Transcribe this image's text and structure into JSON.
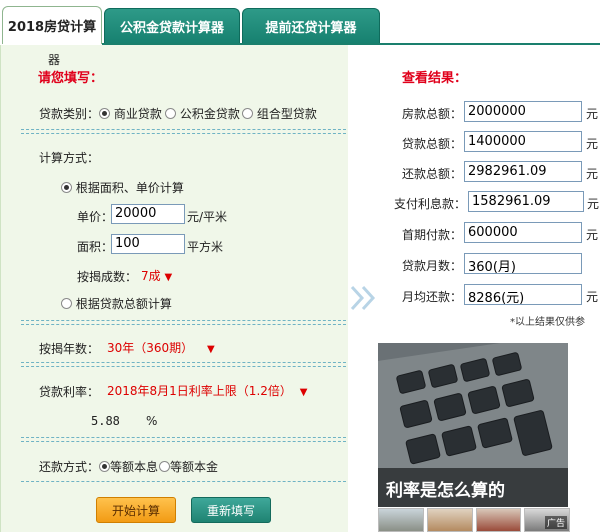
{
  "tabs": [
    {
      "label": "2018房贷计算"
    },
    {
      "label": "公积金贷款计算器"
    },
    {
      "label": "提前还贷计算器"
    }
  ],
  "left": {
    "stray_char": "器",
    "heading": "请您填写：",
    "loan_type": {
      "label": "贷款类别：",
      "options": [
        "商业贷款",
        "公积金贷款",
        "组合型贷款"
      ],
      "selected": 0
    },
    "calc_method": {
      "label": "计算方式：",
      "option_area": "根据面积、单价计算",
      "unit_price_label": "单价：",
      "unit_price_value": "20000",
      "unit_price_unit": "元/平米",
      "area_label": "面积：",
      "area_value": "100",
      "area_unit": "平方米",
      "mortgage_ratio_label": "按揭成数：",
      "mortgage_ratio_value": "7成",
      "option_total": "根据贷款总额计算"
    },
    "years": {
      "label": "按揭年数：",
      "value": "30年（360期）"
    },
    "rate": {
      "label": "贷款利率：",
      "value": "2018年8月1日利率上限（1.2倍）",
      "percent_value": "5.88",
      "percent_unit": "%"
    },
    "repay": {
      "label": "还款方式：",
      "options": [
        "等额本息",
        "等额本金"
      ],
      "selected": 0
    },
    "buttons": {
      "start": "开始计算",
      "reset": "重新填写"
    }
  },
  "right": {
    "heading": "查看结果：",
    "rows": [
      {
        "label": "房款总额：",
        "value": "2000000",
        "unit": "元"
      },
      {
        "label": "贷款总额：",
        "value": "1400000",
        "unit": "元"
      },
      {
        "label": "还款总额：",
        "value": "2982961.09",
        "unit": "元"
      },
      {
        "label": "支付利息款：",
        "value": "1582961.09",
        "unit": "元"
      },
      {
        "label": "首期付款：",
        "value": "600000",
        "unit": "元"
      },
      {
        "label": "贷款月数：",
        "value": "360(月)",
        "unit": ""
      },
      {
        "label": "月均还款：",
        "value": "8286(元)",
        "unit": "元"
      }
    ],
    "note": "*以上结果仅供参"
  },
  "ad": {
    "caption": "利率是怎么算的",
    "badge": "广告"
  },
  "colors": {
    "accent_green": "#1a7f6d",
    "heading_red": "#e0001b",
    "panel_bg": "#f0f7e9"
  }
}
